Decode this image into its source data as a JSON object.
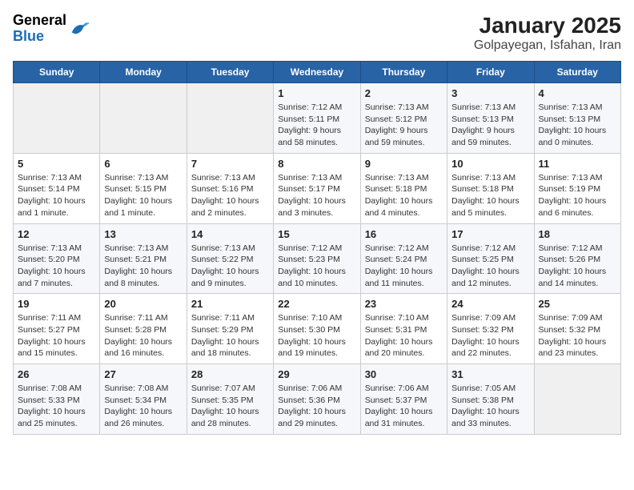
{
  "header": {
    "logo_general": "General",
    "logo_blue": "Blue",
    "title": "January 2025",
    "subtitle": "Golpayegan, Isfahan, Iran"
  },
  "weekdays": [
    "Sunday",
    "Monday",
    "Tuesday",
    "Wednesday",
    "Thursday",
    "Friday",
    "Saturday"
  ],
  "weeks": [
    [
      {
        "day": "",
        "info": ""
      },
      {
        "day": "",
        "info": ""
      },
      {
        "day": "",
        "info": ""
      },
      {
        "day": "1",
        "info": "Sunrise: 7:12 AM\nSunset: 5:11 PM\nDaylight: 9 hours and 58 minutes."
      },
      {
        "day": "2",
        "info": "Sunrise: 7:13 AM\nSunset: 5:12 PM\nDaylight: 9 hours and 59 minutes."
      },
      {
        "day": "3",
        "info": "Sunrise: 7:13 AM\nSunset: 5:13 PM\nDaylight: 9 hours and 59 minutes."
      },
      {
        "day": "4",
        "info": "Sunrise: 7:13 AM\nSunset: 5:13 PM\nDaylight: 10 hours and 0 minutes."
      }
    ],
    [
      {
        "day": "5",
        "info": "Sunrise: 7:13 AM\nSunset: 5:14 PM\nDaylight: 10 hours and 1 minute."
      },
      {
        "day": "6",
        "info": "Sunrise: 7:13 AM\nSunset: 5:15 PM\nDaylight: 10 hours and 1 minute."
      },
      {
        "day": "7",
        "info": "Sunrise: 7:13 AM\nSunset: 5:16 PM\nDaylight: 10 hours and 2 minutes."
      },
      {
        "day": "8",
        "info": "Sunrise: 7:13 AM\nSunset: 5:17 PM\nDaylight: 10 hours and 3 minutes."
      },
      {
        "day": "9",
        "info": "Sunrise: 7:13 AM\nSunset: 5:18 PM\nDaylight: 10 hours and 4 minutes."
      },
      {
        "day": "10",
        "info": "Sunrise: 7:13 AM\nSunset: 5:18 PM\nDaylight: 10 hours and 5 minutes."
      },
      {
        "day": "11",
        "info": "Sunrise: 7:13 AM\nSunset: 5:19 PM\nDaylight: 10 hours and 6 minutes."
      }
    ],
    [
      {
        "day": "12",
        "info": "Sunrise: 7:13 AM\nSunset: 5:20 PM\nDaylight: 10 hours and 7 minutes."
      },
      {
        "day": "13",
        "info": "Sunrise: 7:13 AM\nSunset: 5:21 PM\nDaylight: 10 hours and 8 minutes."
      },
      {
        "day": "14",
        "info": "Sunrise: 7:13 AM\nSunset: 5:22 PM\nDaylight: 10 hours and 9 minutes."
      },
      {
        "day": "15",
        "info": "Sunrise: 7:12 AM\nSunset: 5:23 PM\nDaylight: 10 hours and 10 minutes."
      },
      {
        "day": "16",
        "info": "Sunrise: 7:12 AM\nSunset: 5:24 PM\nDaylight: 10 hours and 11 minutes."
      },
      {
        "day": "17",
        "info": "Sunrise: 7:12 AM\nSunset: 5:25 PM\nDaylight: 10 hours and 12 minutes."
      },
      {
        "day": "18",
        "info": "Sunrise: 7:12 AM\nSunset: 5:26 PM\nDaylight: 10 hours and 14 minutes."
      }
    ],
    [
      {
        "day": "19",
        "info": "Sunrise: 7:11 AM\nSunset: 5:27 PM\nDaylight: 10 hours and 15 minutes."
      },
      {
        "day": "20",
        "info": "Sunrise: 7:11 AM\nSunset: 5:28 PM\nDaylight: 10 hours and 16 minutes."
      },
      {
        "day": "21",
        "info": "Sunrise: 7:11 AM\nSunset: 5:29 PM\nDaylight: 10 hours and 18 minutes."
      },
      {
        "day": "22",
        "info": "Sunrise: 7:10 AM\nSunset: 5:30 PM\nDaylight: 10 hours and 19 minutes."
      },
      {
        "day": "23",
        "info": "Sunrise: 7:10 AM\nSunset: 5:31 PM\nDaylight: 10 hours and 20 minutes."
      },
      {
        "day": "24",
        "info": "Sunrise: 7:09 AM\nSunset: 5:32 PM\nDaylight: 10 hours and 22 minutes."
      },
      {
        "day": "25",
        "info": "Sunrise: 7:09 AM\nSunset: 5:32 PM\nDaylight: 10 hours and 23 minutes."
      }
    ],
    [
      {
        "day": "26",
        "info": "Sunrise: 7:08 AM\nSunset: 5:33 PM\nDaylight: 10 hours and 25 minutes."
      },
      {
        "day": "27",
        "info": "Sunrise: 7:08 AM\nSunset: 5:34 PM\nDaylight: 10 hours and 26 minutes."
      },
      {
        "day": "28",
        "info": "Sunrise: 7:07 AM\nSunset: 5:35 PM\nDaylight: 10 hours and 28 minutes."
      },
      {
        "day": "29",
        "info": "Sunrise: 7:06 AM\nSunset: 5:36 PM\nDaylight: 10 hours and 29 minutes."
      },
      {
        "day": "30",
        "info": "Sunrise: 7:06 AM\nSunset: 5:37 PM\nDaylight: 10 hours and 31 minutes."
      },
      {
        "day": "31",
        "info": "Sunrise: 7:05 AM\nSunset: 5:38 PM\nDaylight: 10 hours and 33 minutes."
      },
      {
        "day": "",
        "info": ""
      }
    ]
  ]
}
